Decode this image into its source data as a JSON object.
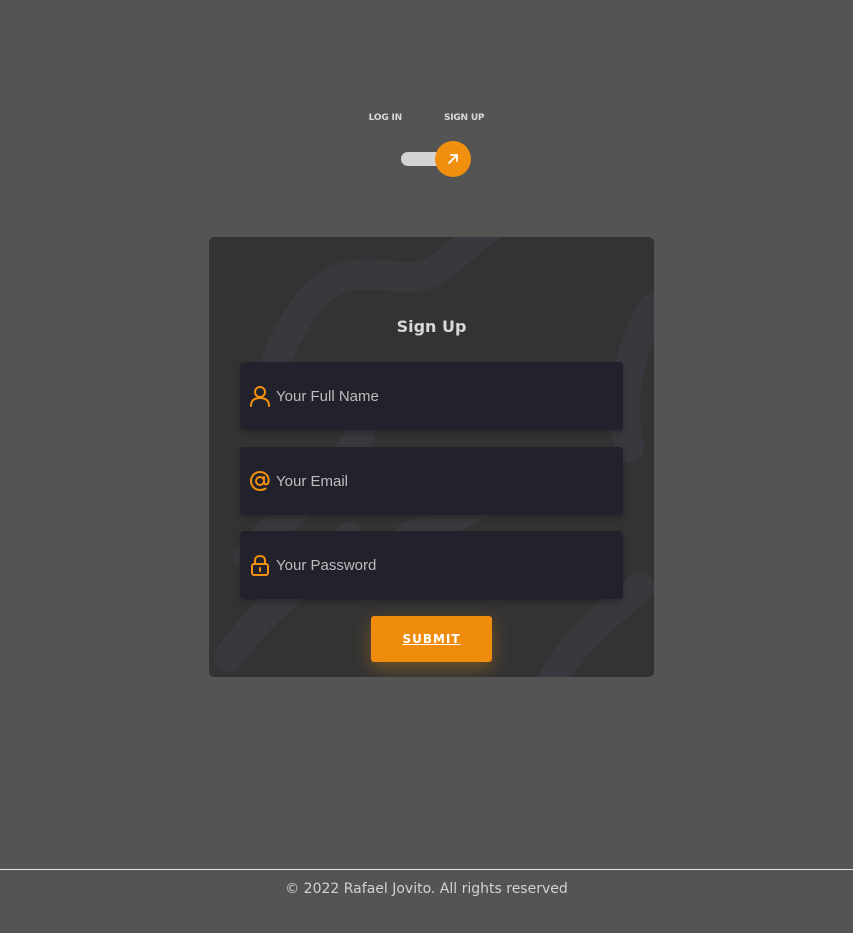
{
  "toggle": {
    "login_label": "LOG IN",
    "signup_label": "SIGN UP",
    "icon": "arrow-up-right-icon"
  },
  "form": {
    "title": "Sign Up",
    "fields": [
      {
        "icon": "user-icon",
        "placeholder": "Your Full Name",
        "value": ""
      },
      {
        "icon": "at-sign-icon",
        "placeholder": "Your Email",
        "value": ""
      },
      {
        "icon": "lock-icon",
        "placeholder": "Your Password",
        "value": ""
      }
    ],
    "submit_label": "SUBMIT"
  },
  "footer": {
    "text": "© 2022 Rafael Jovito. All rights reserved"
  },
  "colors": {
    "background": "#545454",
    "card": "#333333",
    "field": "#22222c",
    "accent": "#f0900e"
  }
}
